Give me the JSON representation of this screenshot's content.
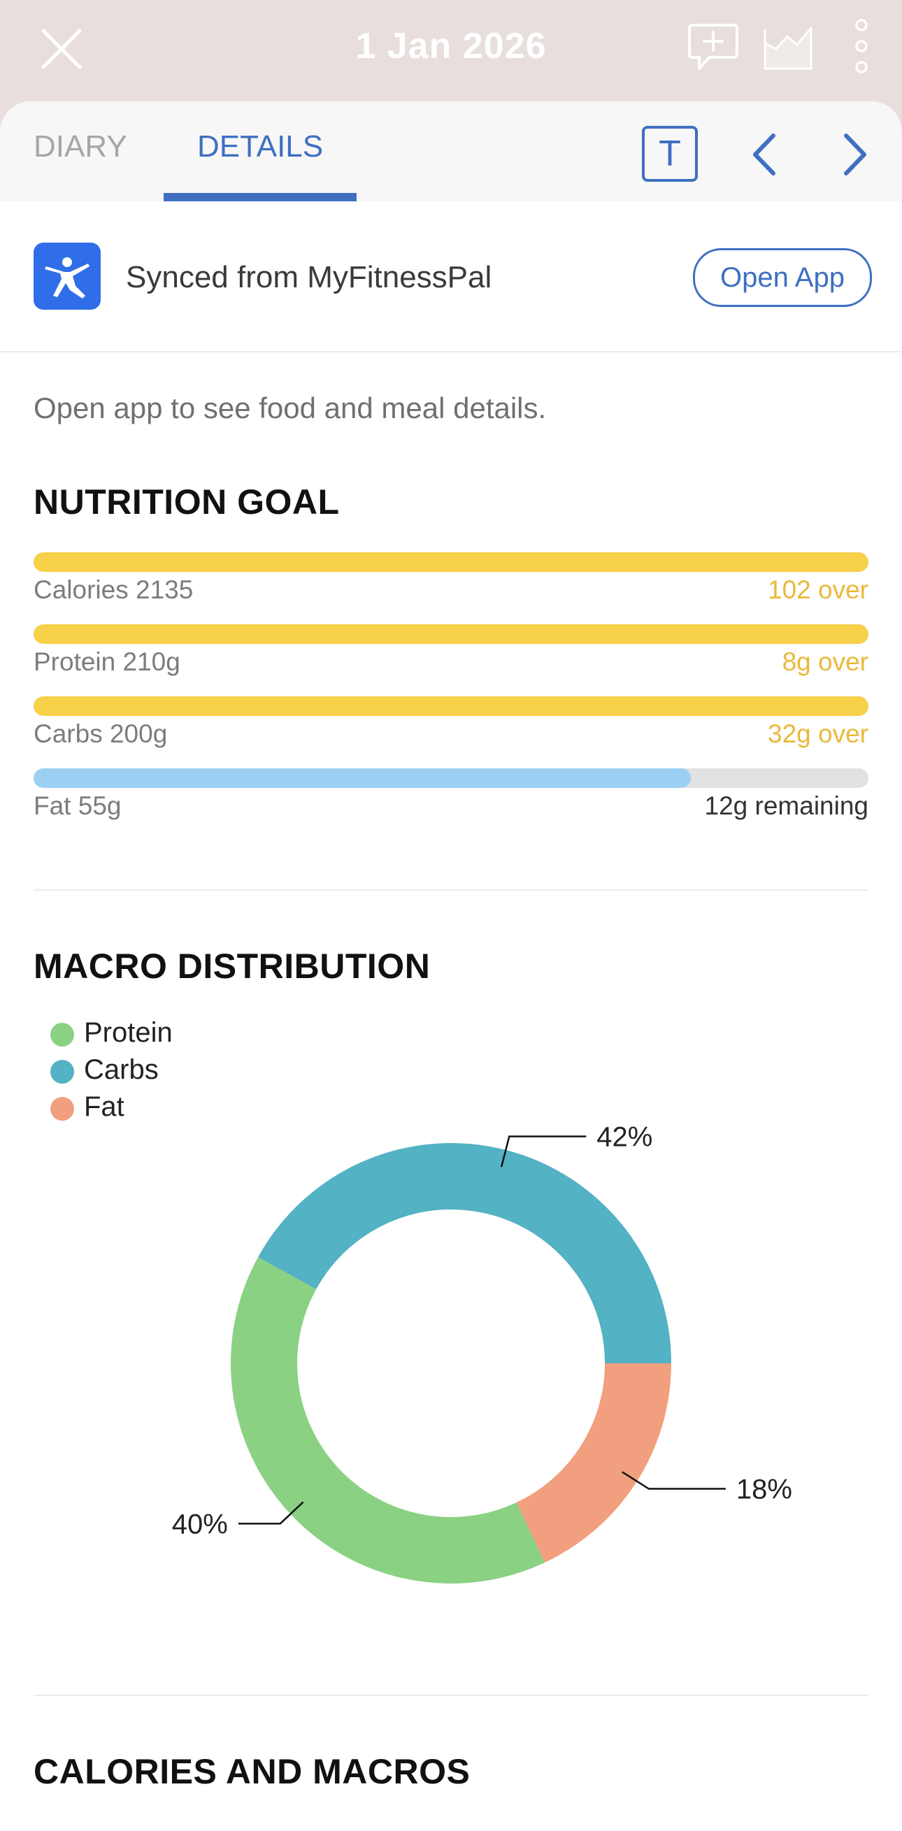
{
  "header": {
    "date": "1 Jan 2026",
    "icons": [
      "close-icon",
      "add-comment-icon",
      "chart-icon",
      "more-vertical-icon"
    ]
  },
  "tabs": [
    {
      "label": "DIARY",
      "active": false
    },
    {
      "label": "DETAILS",
      "active": true
    }
  ],
  "controls": {
    "text_toggle": "T",
    "icons": [
      "previous-chevron-icon",
      "next-chevron-icon"
    ]
  },
  "sync": {
    "text": "Synced from MyFitnessPal",
    "button": "Open App"
  },
  "hint": "Open app to see food and meal details.",
  "nutrition_goal": {
    "title": "NUTRITION GOAL",
    "items": [
      {
        "label": "Calories 2135",
        "status": "102 over",
        "progress": 1.0,
        "state": "over"
      },
      {
        "label": "Protein 210g",
        "status": "8g over",
        "progress": 1.0,
        "state": "over"
      },
      {
        "label": "Carbs 200g",
        "status": "32g over",
        "progress": 1.0,
        "state": "over"
      },
      {
        "label": "Fat 55g",
        "status": "12g remaining",
        "progress": 0.787,
        "state": "remaining"
      }
    ]
  },
  "macro_distribution": {
    "title": "MACRO DISTRIBUTION",
    "legend": [
      {
        "label": "Protein",
        "color": "#8ad184"
      },
      {
        "label": "Carbs",
        "color": "#53b2c3"
      },
      {
        "label": "Fat",
        "color": "#f19f7e"
      }
    ]
  },
  "calories_and_macros": {
    "title": "CALORIES AND MACROS"
  },
  "colors": {
    "accent": "#3f6fc1",
    "over": "#f7d147",
    "over_text": "#e9b93a",
    "fat_fill": "#9bd0f3",
    "track": "#dfe1e3"
  },
  "chart_data": {
    "type": "pie",
    "style": "donut",
    "categories": [
      "Carbs",
      "Protein",
      "Fat"
    ],
    "values": [
      42,
      40,
      18
    ],
    "labels": [
      "42%",
      "40%",
      "18%"
    ],
    "colors": [
      "#53b2c3",
      "#8ad184",
      "#f19f7e"
    ],
    "legend": "top-left"
  }
}
